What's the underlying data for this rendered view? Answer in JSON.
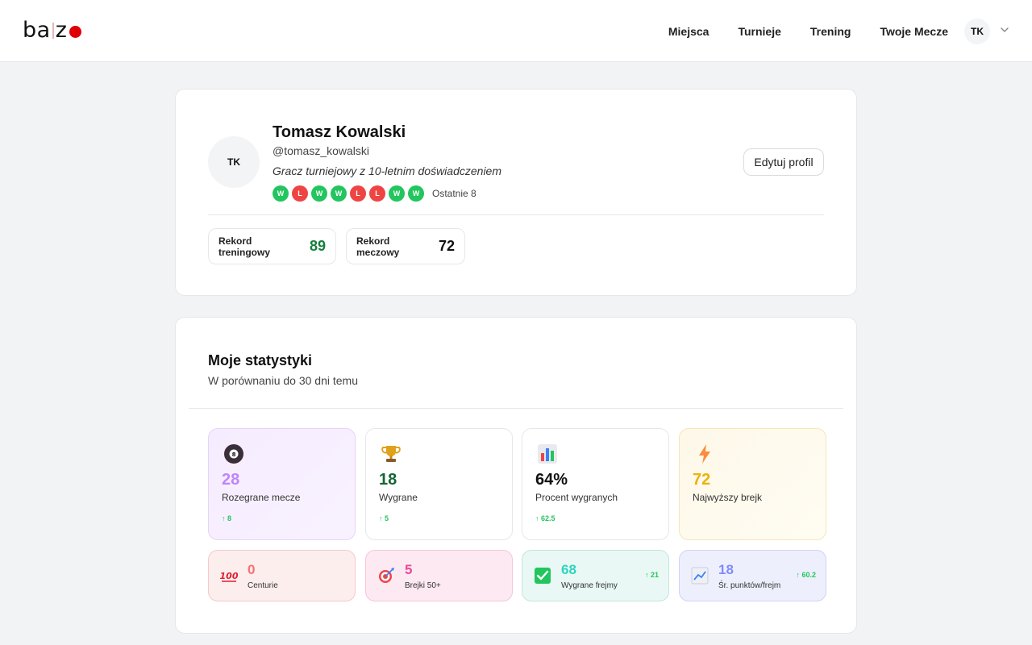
{
  "header": {
    "logo_left": "ba",
    "logo_right": "z",
    "nav": [
      "Miejsca",
      "Turnieje",
      "Trening",
      "Twoje Mecze"
    ],
    "avatar_initials": "TK"
  },
  "profile": {
    "initials": "TK",
    "name": "Tomasz Kowalski",
    "handle": "@tomasz_kowalski",
    "bio": "Gracz turniejowy z 10-letnim doświadczeniem",
    "form": [
      "W",
      "L",
      "W",
      "W",
      "L",
      "L",
      "W",
      "W"
    ],
    "form_label": "Ostatnie 8",
    "edit_label": "Edytuj profil",
    "records": [
      {
        "label": "Rekord treningowy",
        "value": "89"
      },
      {
        "label": "Rekord meczowy",
        "value": "72"
      }
    ]
  },
  "stats": {
    "title": "Moje statystyki",
    "subtitle": "W porównaniu do 30 dni temu",
    "main": [
      {
        "icon": "eight-ball-icon",
        "value": "28",
        "label": "Rozegrane mecze",
        "trend": "↑ 8"
      },
      {
        "icon": "trophy-icon",
        "value": "18",
        "label": "Wygrane",
        "trend": "↑ 5"
      },
      {
        "icon": "bar-chart-icon",
        "value": "64%",
        "label": "Procent wygranych",
        "trend": "↑ 62.5"
      },
      {
        "icon": "lightning-icon",
        "value": "72",
        "label": "Najwyższy brejk",
        "trend": ""
      }
    ],
    "secondary": [
      {
        "icon": "hundred-icon",
        "value": "0",
        "label": "Centurie",
        "trend": ""
      },
      {
        "icon": "target-icon",
        "value": "5",
        "label": "Brejki 50+",
        "trend": ""
      },
      {
        "icon": "checkmark-icon",
        "value": "68",
        "label": "Wygrane frejmy",
        "trend": "↑ 21"
      },
      {
        "icon": "trend-chart-icon",
        "value": "18",
        "label": "Śr. punktów/frejm",
        "trend": "↑ 60.2"
      }
    ]
  },
  "colors": {
    "win": "#22c55e",
    "loss": "#ef4444",
    "brand_dot": "#e00000"
  }
}
